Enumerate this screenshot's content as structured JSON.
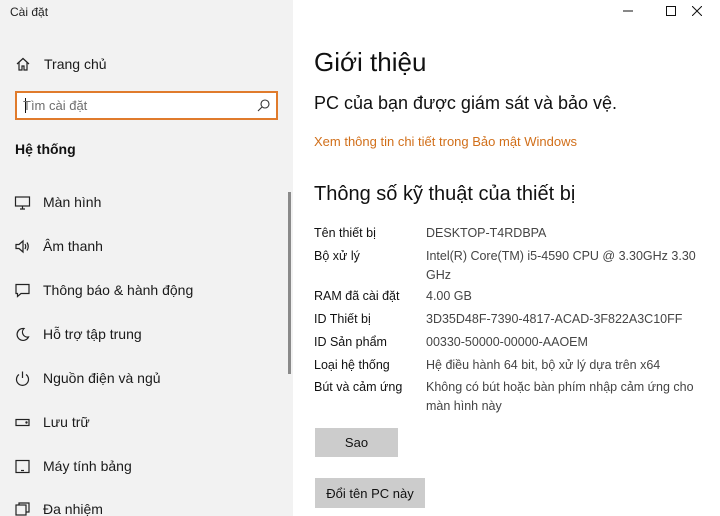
{
  "window": {
    "title": "Cài đặt",
    "controls": [
      "minimize-icon",
      "maximize-icon",
      "close-icon"
    ]
  },
  "sidebar": {
    "home": {
      "label": "Trang chủ",
      "icon": "home-icon"
    },
    "search": {
      "placeholder": "Tìm cài đặt",
      "value": "",
      "icon": "search-icon"
    },
    "section_heading": "Hệ thống",
    "items": [
      {
        "label": "Màn hình",
        "icon": "display-icon"
      },
      {
        "label": "Âm thanh",
        "icon": "sound-icon"
      },
      {
        "label": "Thông báo & hành động",
        "icon": "notification-icon"
      },
      {
        "label": "Hỗ trợ tập trung",
        "icon": "focus-assist-icon"
      },
      {
        "label": "Nguồn điện và ngủ",
        "icon": "power-icon"
      },
      {
        "label": "Lưu trữ",
        "icon": "storage-icon"
      },
      {
        "label": "Máy tính bảng",
        "icon": "tablet-icon"
      },
      {
        "label": "Đa nhiệm",
        "icon": "multitasking-icon"
      }
    ]
  },
  "main": {
    "title": "Giới thiệu",
    "status": "PC của bạn được giám sát và bảo vệ.",
    "security_link": "Xem thông tin chi tiết trong Bảo mật Windows",
    "spec_heading": "Thông số kỹ thuật của thiết bị",
    "specs": [
      {
        "key": "Tên thiết bị",
        "value": "DESKTOP-T4RDBPA"
      },
      {
        "key": "Bộ xử lý",
        "value": "Intel(R) Core(TM) i5-4590 CPU @ 3.30GHz   3.30 GHz"
      },
      {
        "key": "RAM đã cài đặt",
        "value": "4.00 GB"
      },
      {
        "key": "ID Thiết bị",
        "value": "3D35D48F-7390-4817-ACAD-3F822A3C10FF"
      },
      {
        "key": "ID Sản phẩm",
        "value": "00330-50000-00000-AAOEM"
      },
      {
        "key": "Loại hệ thống",
        "value": "Hệ điều hành 64 bit, bộ xử lý dựa trên x64"
      },
      {
        "key": "Bút và cảm ứng",
        "value": "Không có bút hoặc bàn phím nhập cảm ứng cho màn hình này"
      }
    ],
    "copy_button": "Sao",
    "rename_button": "Đổi tên PC này"
  },
  "colors": {
    "accent": "#e07b2c",
    "link": "#d16f1a",
    "sidebar_bg": "#f2f2f2",
    "button_bg": "#cccccc"
  }
}
